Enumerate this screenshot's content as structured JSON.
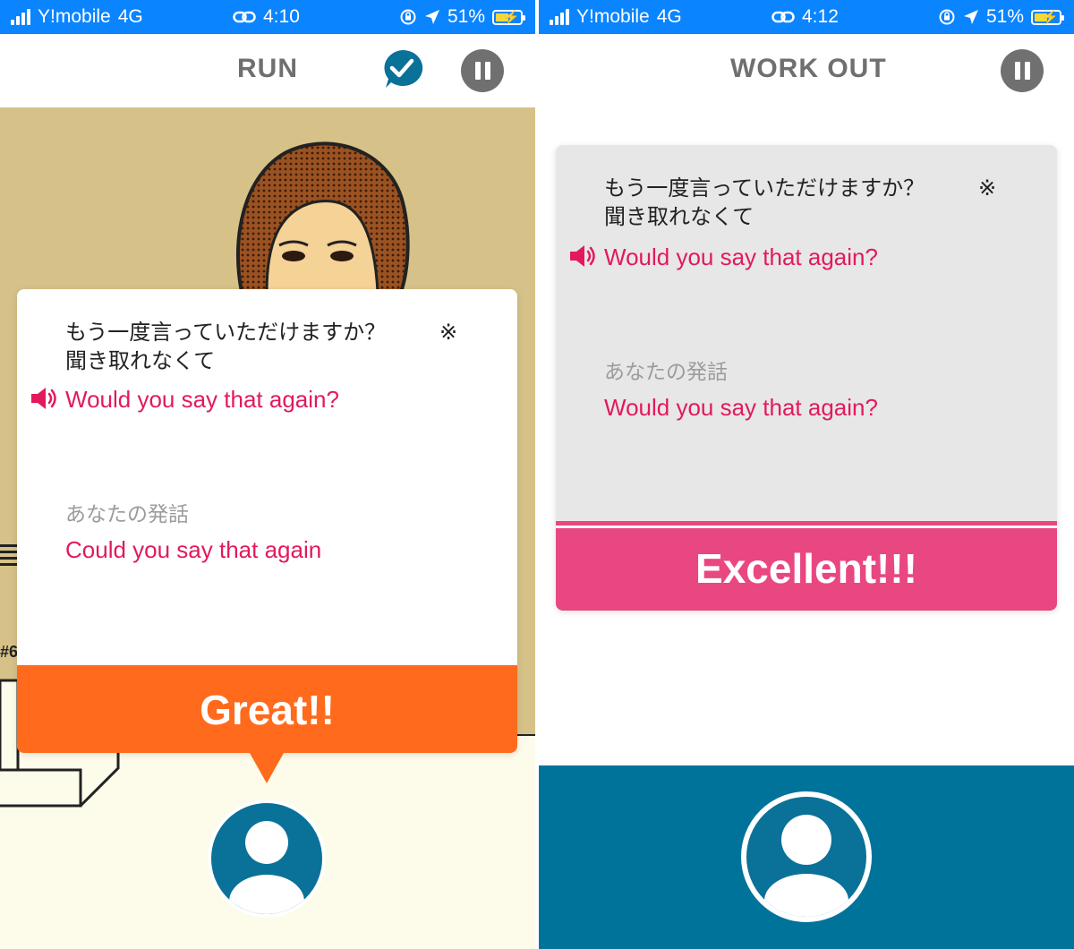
{
  "left": {
    "status": {
      "carrier": "Y!mobile",
      "network": "4G",
      "time": "4:10",
      "battery": "51%"
    },
    "header": {
      "title": "RUN"
    },
    "card": {
      "jp_line1": "もう一度言っていただけますか？",
      "jp_mark": "※",
      "jp_line2": "聞き取れなくて",
      "target_phrase": "Would you say that again?",
      "speech_label": "あなたの発話",
      "user_speech": "Could you say that again",
      "result": "Great!!"
    },
    "scene": {
      "label": "#6"
    }
  },
  "right": {
    "status": {
      "carrier": "Y!mobile",
      "network": "4G",
      "time": "4:12",
      "battery": "51%"
    },
    "header": {
      "title": "WORK OUT"
    },
    "card": {
      "jp_line1": "もう一度言っていただけますか？",
      "jp_mark": "※",
      "jp_line2": "聞き取れなくて",
      "target_phrase": "Would you say that again?",
      "speech_label": "あなたの発話",
      "user_speech": "Would you say that again?",
      "result": "Excellent!!!"
    }
  },
  "colors": {
    "status_bar": "#0a84ff",
    "accent_red": "#e2195e",
    "great_orange": "#ff6a1c",
    "excellent_pink": "#e94781",
    "mic_blue": "#0a7198",
    "bottom_panel_blue": "#00739b",
    "scene_tan": "#d6c288"
  },
  "icons": {
    "check": "check-bubble-icon",
    "pause": "pause-icon",
    "speaker": "speaker-icon",
    "user": "user-icon"
  }
}
